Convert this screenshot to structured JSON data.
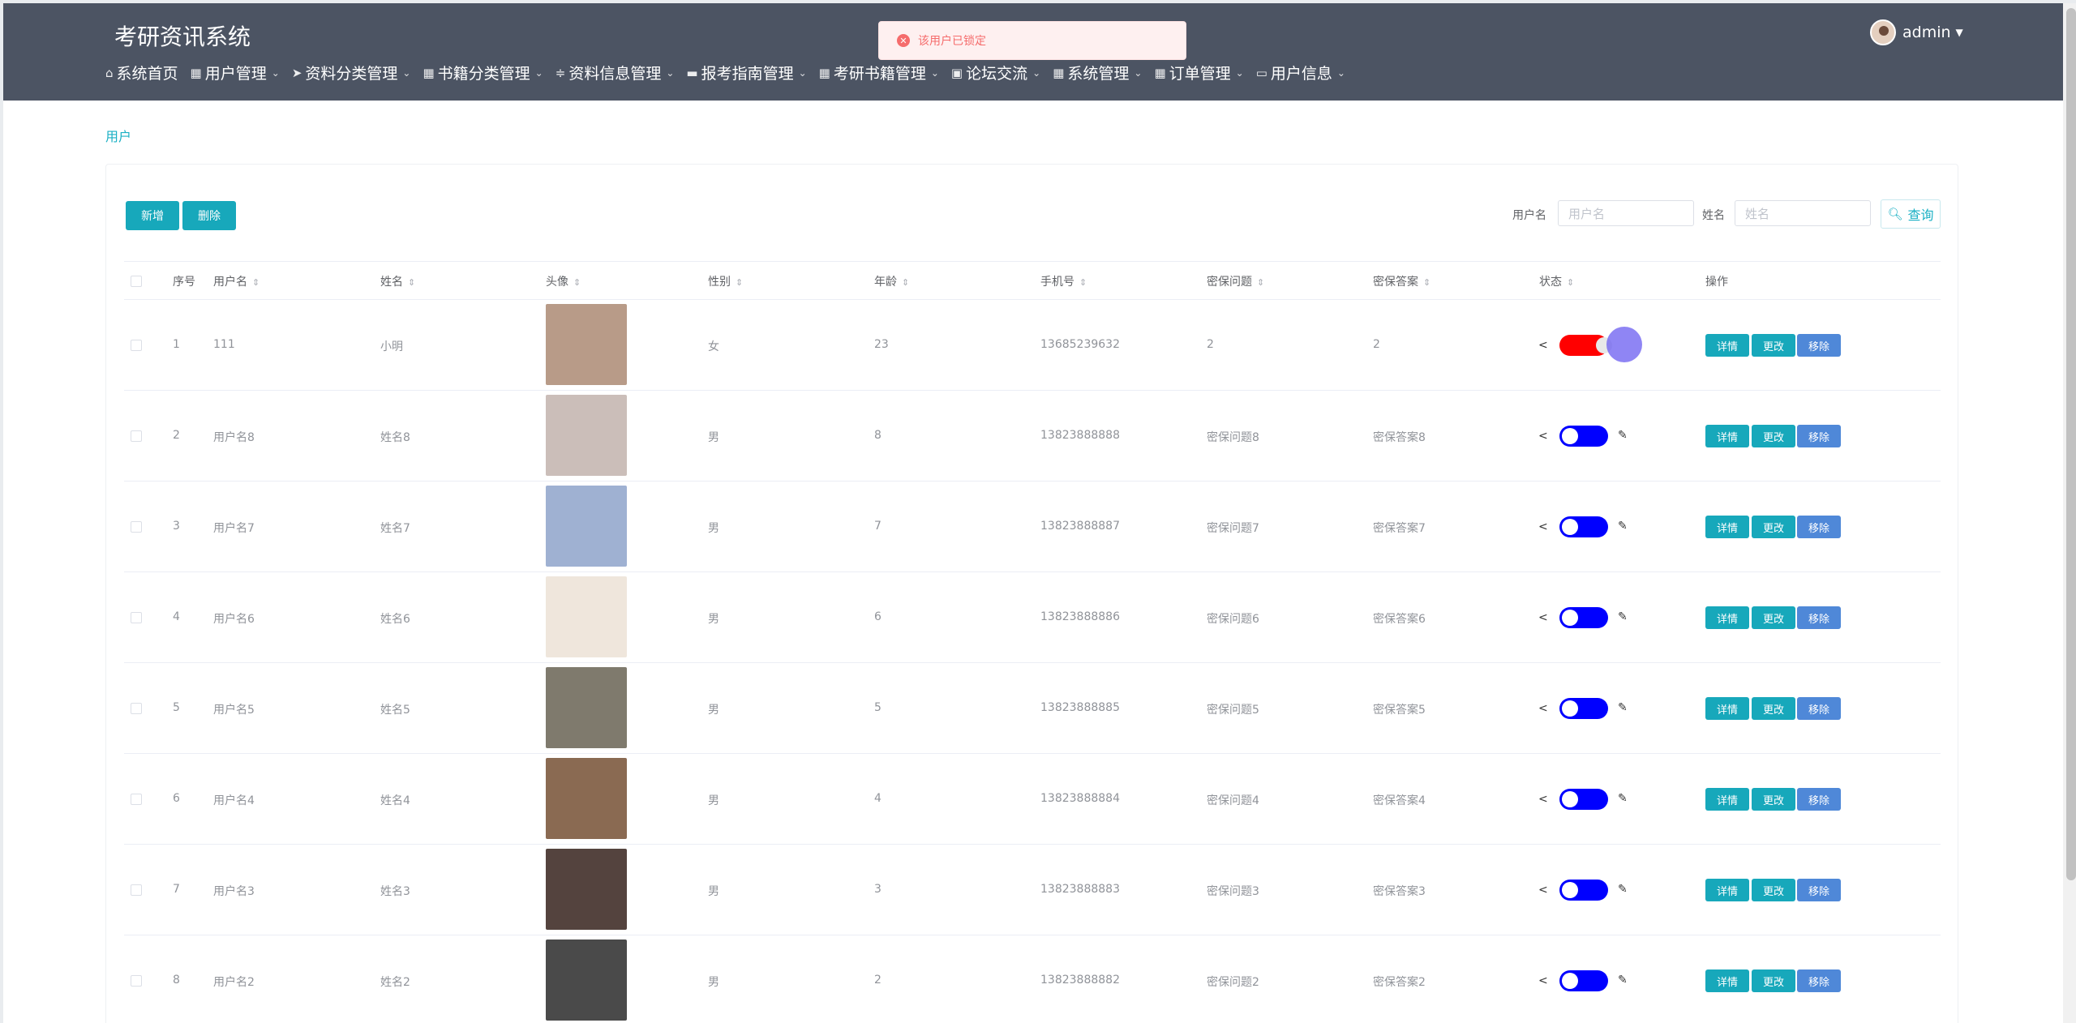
{
  "app": {
    "title": "考研资讯系统"
  },
  "nav": [
    {
      "icon": "home-icon",
      "glyph": "⌂",
      "label": "系统首页",
      "dropdown": false
    },
    {
      "icon": "grid-icon",
      "glyph": "▦",
      "label": "用户管理",
      "dropdown": true
    },
    {
      "icon": "send-icon",
      "glyph": "➤",
      "label": "资料分类管理",
      "dropdown": true
    },
    {
      "icon": "grid-icon",
      "glyph": "▦",
      "label": "书籍分类管理",
      "dropdown": true
    },
    {
      "icon": "sliders-icon",
      "glyph": "≑",
      "label": "资料信息管理",
      "dropdown": true
    },
    {
      "icon": "printer-icon",
      "glyph": "▬",
      "label": "报考指南管理",
      "dropdown": true
    },
    {
      "icon": "grid-icon",
      "glyph": "▦",
      "label": "考研书籍管理",
      "dropdown": true
    },
    {
      "icon": "forum-icon",
      "glyph": "▣",
      "label": "论坛交流",
      "dropdown": true
    },
    {
      "icon": "grid-icon",
      "glyph": "▦",
      "label": "系统管理",
      "dropdown": true
    },
    {
      "icon": "grid-icon",
      "glyph": "▦",
      "label": "订单管理",
      "dropdown": true
    },
    {
      "icon": "card-icon",
      "glyph": "▭",
      "label": "用户信息",
      "dropdown": true
    }
  ],
  "user": {
    "name": "admin"
  },
  "toast": {
    "message": "该用户已锁定"
  },
  "breadcrumb": "用户",
  "actions": {
    "add": "新增",
    "delete": "删除"
  },
  "search": {
    "username_label": "用户名",
    "username_placeholder": "用户名",
    "name_label": "姓名",
    "name_placeholder": "姓名",
    "button": "查询"
  },
  "table": {
    "headers": {
      "index": "序号",
      "username": "用户名",
      "name": "姓名",
      "avatar": "头像",
      "gender": "性别",
      "age": "年龄",
      "phone": "手机号",
      "question": "密保问题",
      "answer": "密保答案",
      "status": "状态",
      "ops": "操作"
    },
    "op_labels": {
      "detail": "详情",
      "edit": "更改",
      "remove": "移除"
    },
    "rows": [
      {
        "index": "1",
        "username": "111",
        "name": "小明",
        "gender": "女",
        "age": "23",
        "phone": "13685239632",
        "question": "2",
        "answer": "2",
        "locked": true,
        "photo": "#b89b88"
      },
      {
        "index": "2",
        "username": "用户名8",
        "name": "姓名8",
        "gender": "男",
        "age": "8",
        "phone": "13823888888",
        "question": "密保问题8",
        "answer": "密保答案8",
        "locked": false,
        "photo": "#cbbeb9"
      },
      {
        "index": "3",
        "username": "用户名7",
        "name": "姓名7",
        "gender": "男",
        "age": "7",
        "phone": "13823888887",
        "question": "密保问题7",
        "answer": "密保答案7",
        "locked": false,
        "photo": "#9fb1d2"
      },
      {
        "index": "4",
        "username": "用户名6",
        "name": "姓名6",
        "gender": "男",
        "age": "6",
        "phone": "13823888886",
        "question": "密保问题6",
        "answer": "密保答案6",
        "locked": false,
        "photo": "#efe6dc"
      },
      {
        "index": "5",
        "username": "用户名5",
        "name": "姓名5",
        "gender": "男",
        "age": "5",
        "phone": "13823888885",
        "question": "密保问题5",
        "answer": "密保答案5",
        "locked": false,
        "photo": "#7f7a6d"
      },
      {
        "index": "6",
        "username": "用户名4",
        "name": "姓名4",
        "gender": "男",
        "age": "4",
        "phone": "13823888884",
        "question": "密保问题4",
        "answer": "密保答案4",
        "locked": false,
        "photo": "#8a6a52"
      },
      {
        "index": "7",
        "username": "用户名3",
        "name": "姓名3",
        "gender": "男",
        "age": "3",
        "phone": "13823888883",
        "question": "密保问题3",
        "answer": "密保答案3",
        "locked": false,
        "photo": "#54433e"
      },
      {
        "index": "8",
        "username": "用户名2",
        "name": "姓名2",
        "gender": "男",
        "age": "2",
        "phone": "13823888882",
        "question": "密保问题2",
        "answer": "密保答案2",
        "locked": false,
        "photo": "#4a4a4a"
      }
    ]
  },
  "colors": {
    "header_bg": "#4c5463",
    "accent": "#17a8bb",
    "remove_btn": "#4f88d8",
    "switch_on": "#ff0000",
    "switch_off": "#0000ff",
    "toast_text": "#f56c6c"
  }
}
